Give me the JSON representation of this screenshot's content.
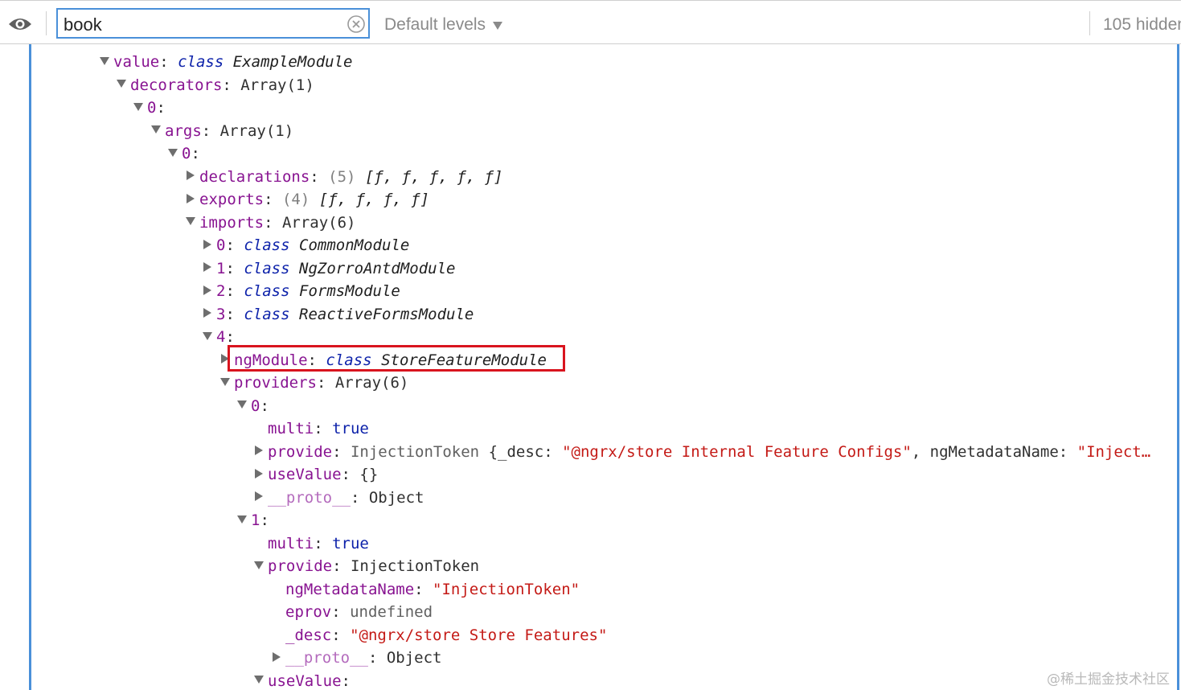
{
  "toolbar": {
    "eye_icon": "eye-icon",
    "filter_value": "book",
    "clear_icon": "clear-circle-icon",
    "levels_label": "Default levels",
    "levels_icon": "caret-down-icon",
    "hidden_label": "105 hidden"
  },
  "colors": {
    "accent": "#4a90d9",
    "highlight_box": "#d9141e",
    "key": "#881391",
    "keyword": "#0d22aa",
    "string": "#c41a16"
  },
  "tree": {
    "rows": [
      {
        "toggle": "down",
        "key": "value",
        "sep": ": ",
        "kw": "class",
        "cls": "ExampleModule"
      },
      {
        "toggle": "down",
        "key": "decorators",
        "sep": ": ",
        "val": "Array(1)"
      },
      {
        "toggle": "down",
        "key": "0",
        "sep": ":"
      },
      {
        "toggle": "down",
        "key": "args",
        "sep": ": ",
        "val": "Array(1)"
      },
      {
        "toggle": "down",
        "key": "0",
        "sep": ":"
      },
      {
        "toggle": "right",
        "key": "declarations",
        "sep": ": ",
        "count": "(5)",
        "preview": "[ƒ, ƒ, ƒ, ƒ, ƒ]"
      },
      {
        "toggle": "right",
        "key": "exports",
        "sep": ": ",
        "count": "(4)",
        "preview": "[ƒ, ƒ, ƒ, ƒ]"
      },
      {
        "toggle": "down",
        "key": "imports",
        "sep": ": ",
        "val": "Array(6)"
      },
      {
        "toggle": "right",
        "key": "0",
        "sep": ": ",
        "kw": "class",
        "cls": "CommonModule"
      },
      {
        "toggle": "right",
        "key": "1",
        "sep": ": ",
        "kw": "class",
        "cls": "NgZorroAntdModule"
      },
      {
        "toggle": "right",
        "key": "2",
        "sep": ": ",
        "kw": "class",
        "cls": "FormsModule"
      },
      {
        "toggle": "right",
        "key": "3",
        "sep": ": ",
        "kw": "class",
        "cls": "ReactiveFormsModule"
      },
      {
        "toggle": "down",
        "key": "4",
        "sep": ":"
      },
      {
        "toggle": "right",
        "key": "ngModule",
        "sep": ": ",
        "kw": "class",
        "cls": "StoreFeatureModule"
      },
      {
        "toggle": "down",
        "key": "providers",
        "sep": ": ",
        "val": "Array(6)"
      },
      {
        "toggle": "down",
        "key": "0",
        "sep": ":"
      },
      {
        "toggle": "none",
        "key": "multi",
        "sep": ": ",
        "bool": "true"
      },
      {
        "toggle": "right",
        "key": "provide",
        "sep": ": ",
        "gray": "InjectionToken",
        "rest1": " {_desc: ",
        "str1": "\"@ngrx/store Internal Feature Configs\"",
        "rest2": ", ngMetadataName: ",
        "str2": "\"Inject…"
      },
      {
        "toggle": "right",
        "key": "useValue",
        "sep": ": ",
        "val": "{}"
      },
      {
        "toggle": "right",
        "key": "__proto__",
        "dim": true,
        "sep": ": ",
        "val": "Object"
      },
      {
        "toggle": "down",
        "key": "1",
        "sep": ":"
      },
      {
        "toggle": "none",
        "key": "multi",
        "sep": ": ",
        "bool": "true"
      },
      {
        "toggle": "down",
        "key": "provide",
        "sep": ": ",
        "val": "InjectionToken"
      },
      {
        "toggle": "none",
        "key": "ngMetadataName",
        "sep": ": ",
        "str1": "\"InjectionToken\""
      },
      {
        "toggle": "none",
        "key": "eprov",
        "sep": ": ",
        "undef": "undefined"
      },
      {
        "toggle": "none",
        "key": "_desc",
        "sep": ": ",
        "str1": "\"@ngrx/store Store Features\""
      },
      {
        "toggle": "right",
        "key": "__proto__",
        "dim": true,
        "sep": ": ",
        "val": "Object"
      },
      {
        "toggle": "down",
        "key": "useValue",
        "sep": ":"
      }
    ]
  },
  "watermark": "@稀土掘金技术社区"
}
